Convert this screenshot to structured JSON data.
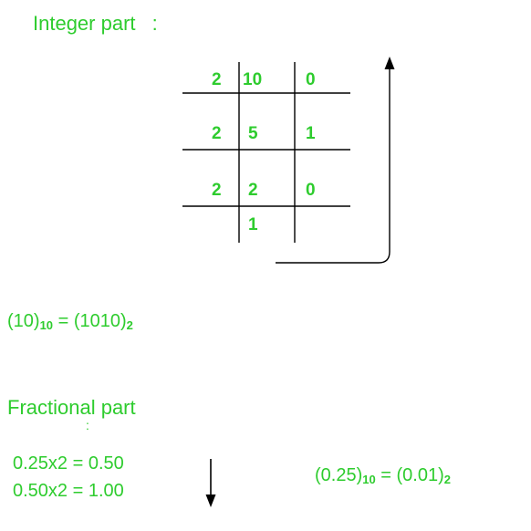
{
  "colors": {
    "accent": "#2ecc2e",
    "ink": "#000000"
  },
  "integer_section": {
    "heading": "Integer part",
    "heading_colon": ":",
    "division_rows": [
      {
        "divisor": "2",
        "dividend": "10",
        "remainder": "0"
      },
      {
        "divisor": "2",
        "dividend": "5",
        "remainder": "1"
      },
      {
        "divisor": "2",
        "dividend": "2",
        "remainder": "0"
      }
    ],
    "final_quotient": "1",
    "arrow_direction": "up",
    "result": {
      "open": "(10)",
      "base_from": "10",
      "middle": " = (1010)",
      "base_to": "2"
    }
  },
  "fractional_section": {
    "heading": "Fractional part",
    "heading_colon": ":",
    "steps": [
      "0.25x2 = 0.50",
      "0.50x2 = 1.00"
    ],
    "arrow_direction": "down",
    "result": {
      "open": "(0.25)",
      "base_from": "10",
      "middle": " = (0.01)",
      "base_to": "2"
    }
  }
}
